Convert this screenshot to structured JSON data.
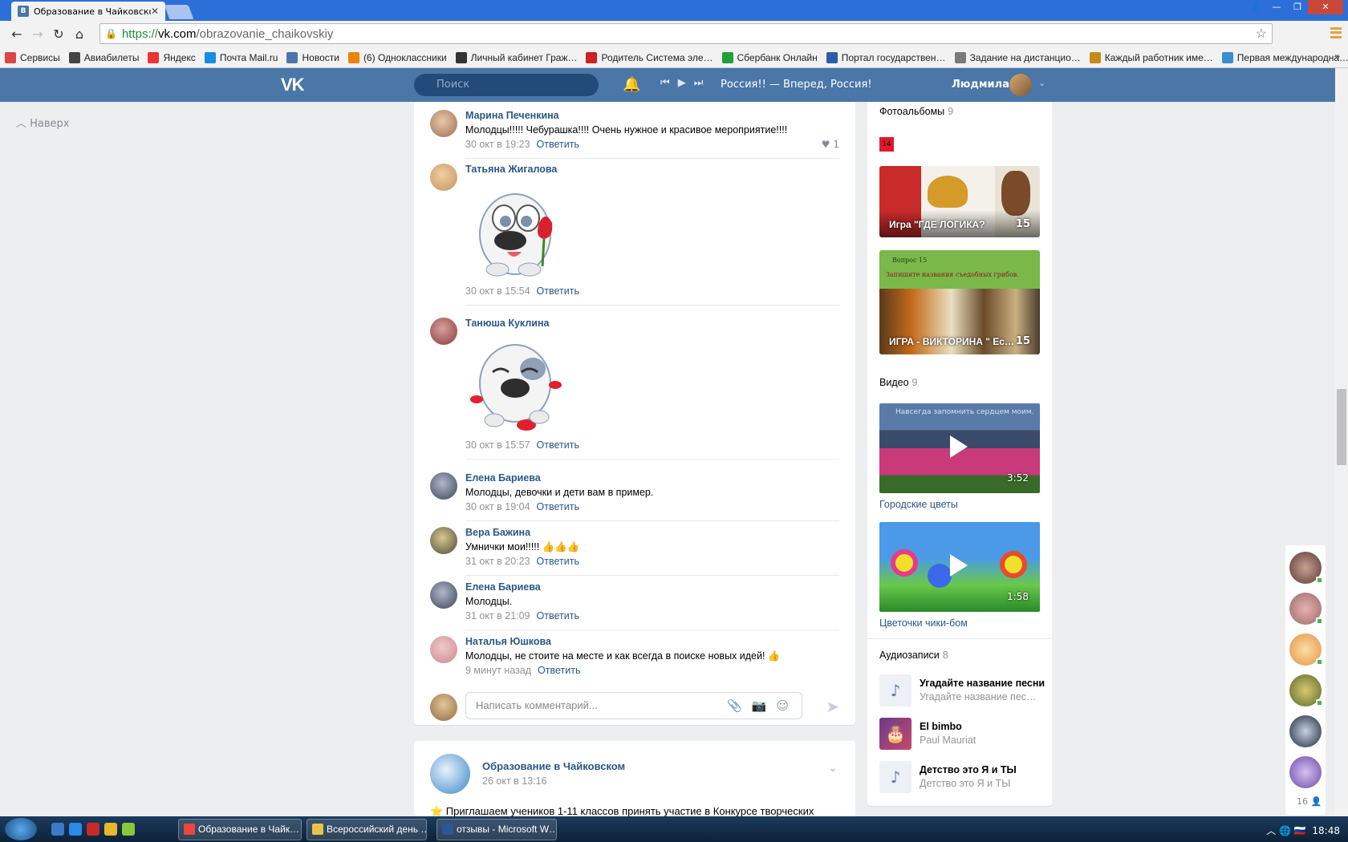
{
  "browser": {
    "tab_title": "Образование в Чайковском",
    "url_scheme": "https://",
    "url_host": "vk.com",
    "url_path": "/obrazovanie_chaikovskiy",
    "bookmarks": [
      {
        "label": "Сервисы",
        "color": "#d44"
      },
      {
        "label": "Авиабилеты",
        "color": "#444"
      },
      {
        "label": "Яндекс",
        "color": "#e33"
      },
      {
        "label": "Почта Mail.ru",
        "color": "#168de2"
      },
      {
        "label": "Новости",
        "color": "#4a76a8"
      },
      {
        "label": "(6) Одноклассники",
        "color": "#ee8208"
      },
      {
        "label": "Личный кабинет Граж…",
        "color": "#333"
      },
      {
        "label": "Родитель Система эле…",
        "color": "#c22"
      },
      {
        "label": "Сбербанк Онлайн",
        "color": "#21a038"
      },
      {
        "label": "Портал государствен…",
        "color": "#2a5caa"
      },
      {
        "label": "Задание на дистанцио…",
        "color": "#7a7a7a"
      },
      {
        "label": "Каждый работник име…",
        "color": "#c78a1a"
      },
      {
        "label": "Первая международна…",
        "color": "#3c8dd0"
      }
    ]
  },
  "vk": {
    "search_placeholder": "Поиск",
    "now_playing": "Россия!! — Вперед, Россия!",
    "user_name": "Людмила",
    "up_label": "Наверх"
  },
  "comments": [
    {
      "author": "Марина Печенкина",
      "text": "Молодцы!!!!! Чебурашка!!!! Очень нужное и красивое мероприятие!!!!",
      "date": "30 окт в 19:23",
      "reply": "Ответить",
      "likes": "1"
    },
    {
      "author": "Татьяна Жигалова",
      "sticker": "dog-with-rose-sticker",
      "date": "30 окт в 15:54",
      "reply": "Ответить"
    },
    {
      "author": "Танюша Куклина",
      "sticker": "dog-with-kisses-sticker",
      "date": "30 окт в 15:57",
      "reply": "Ответить"
    },
    {
      "author": "Елена Бариева",
      "text": "Молодцы, девочки и дети вам в пример.",
      "date": "30 окт в 19:04",
      "reply": "Ответить"
    },
    {
      "author": "Вера Бажина",
      "text": "Умнички мои!!!!! 👍👍👍",
      "date": "31 окт в 20:23",
      "reply": "Ответить"
    },
    {
      "author": "Елена Бариева",
      "text": "Молодцы.",
      "date": "31 окт в 21:09",
      "reply": "Ответить"
    },
    {
      "author": "Наталья Юшкова",
      "text": "Молодцы, не стоите на месте и как всегда в поиске новых идей! 👍",
      "date": "9 минут назад",
      "reply": "Ответить"
    }
  ],
  "composer": {
    "placeholder": "Написать комментарий..."
  },
  "post": {
    "author": "Образование в Чайковском",
    "date": "26 окт в 13:16",
    "text": "⭐ Приглашаем учеников 1-11 классов принять участие в Конкурсе творческих"
  },
  "sidebar": {
    "albums_title": "Фотоальбомы",
    "albums_count": "9",
    "badge": "14",
    "albums": [
      {
        "caption": "Игра \"ГДЕ ЛОГИКА?",
        "count": "15"
      },
      {
        "caption": "ИГРА - ВИКТОРИНА \" Ес…",
        "count": "15",
        "thumb_title": "Вопрос 15",
        "thumb_sub": "Запишите названия съедобных грибов."
      }
    ],
    "videos_title": "Видео",
    "videos_count": "9",
    "videos": [
      {
        "title": "Городские цветы",
        "duration": "3:52",
        "overlay": "Навсегда запомнить сердцем моим."
      },
      {
        "title": "Цветочки чики-бом",
        "duration": "1:58"
      }
    ],
    "audio_title": "Аудиозаписи",
    "audio_count": "8",
    "audios": [
      {
        "title": "Угадайте название песни",
        "artist": "Угадайте название пес…"
      },
      {
        "title": "El bimbo",
        "artist": "Paul Mauriat"
      },
      {
        "title": "Детство это Я и ТЫ",
        "artist": "Детство это Я и ТЫ"
      }
    ],
    "friends_online": "16"
  },
  "taskbar": {
    "items": [
      {
        "label": "Образование в Чайк…",
        "color": "#e44"
      },
      {
        "label": "Всероссийский день …",
        "color": "#e8c34a"
      },
      {
        "label": "отзывы - Microsoft W…",
        "color": "#2b579a"
      }
    ],
    "clock": "18:48"
  }
}
